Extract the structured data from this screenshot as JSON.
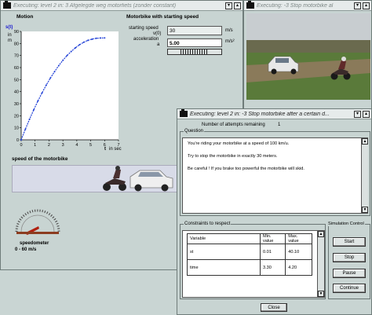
{
  "window1": {
    "title": "Executing: level 2  in: 3  Afgelegde weg motorfiets (zonder constant)",
    "motion_label": "Motion",
    "y_axis_label": "s(t)",
    "y_axis_unit_in": "in",
    "y_axis_unit": "m",
    "y_ticks": [
      "90",
      "80",
      "70",
      "60",
      "50",
      "40",
      "30",
      "20",
      "10",
      "0"
    ],
    "x_ticks": [
      "0",
      "1",
      "2",
      "3",
      "4",
      "5",
      "6",
      "7"
    ],
    "x_axis_label": "t",
    "x_axis_unit": "in sec",
    "panel_title": "Motorbike with starting speed",
    "starting_speed_label": "starting speed",
    "starting_speed_symbol": "v(0)",
    "starting_speed_value": "30",
    "starting_speed_unit": "m/s",
    "acceleration_label": "acceleration",
    "acceleration_symbol": "a",
    "acceleration_value": "5.00",
    "acceleration_unit": "m/s²",
    "speed_label": "speed of the motorbike",
    "speedometer_label": "speedometer",
    "speedometer_range": "0 - 60 m/s"
  },
  "window2": {
    "title": "Executing: -3  Stop motorbike al"
  },
  "window3": {
    "title": "Executing: level 2  in: -3  Stop motorbike after a certain d...",
    "attempts_label": "Number of attempts remaining",
    "attempts_value": "1",
    "question_label": "Question",
    "question_lines": [
      "You're riding your motorbike at a speed of 100 km/u.",
      "Try to stop the motorbike in exactly 30 meters.",
      "Be careful ! If you brake too powerful the motorbike will skid."
    ],
    "constraints_label": "Constraints to respect",
    "table_headers": [
      "Variable",
      "Min. value",
      "Max. value"
    ],
    "table_rows": [
      {
        "variable": "st",
        "min": "0.01",
        "max": "40.10"
      },
      {
        "variable": "time",
        "min": "3.30",
        "max": "4.20"
      }
    ],
    "simulation_label": "Simulation Control",
    "sim_buttons": [
      "Start",
      "Stop",
      "Pause",
      "Continue"
    ],
    "close_label": "Close"
  },
  "chart_data": {
    "type": "line",
    "title": "Motion",
    "xlabel": "t in sec",
    "ylabel": "s(t) in m",
    "xlim": [
      0,
      7
    ],
    "ylim": [
      0,
      90
    ],
    "series": [
      {
        "x": [
          0.0,
          0.3,
          0.6,
          0.9,
          1.2,
          1.5,
          1.8,
          2.1,
          2.4,
          2.7,
          3.0,
          3.3,
          3.6,
          3.9,
          4.2,
          4.5,
          4.8,
          5.1,
          5.4,
          5.7,
          6.0
        ],
        "y": [
          0.0,
          8.8,
          17.1,
          24.9,
          32.2,
          39.0,
          45.4,
          51.3,
          56.6,
          61.6,
          66.0,
          70.0,
          73.4,
          76.4,
          79.0,
          81.0,
          82.6,
          83.6,
          84.3,
          84.5,
          84.6
        ]
      }
    ]
  }
}
